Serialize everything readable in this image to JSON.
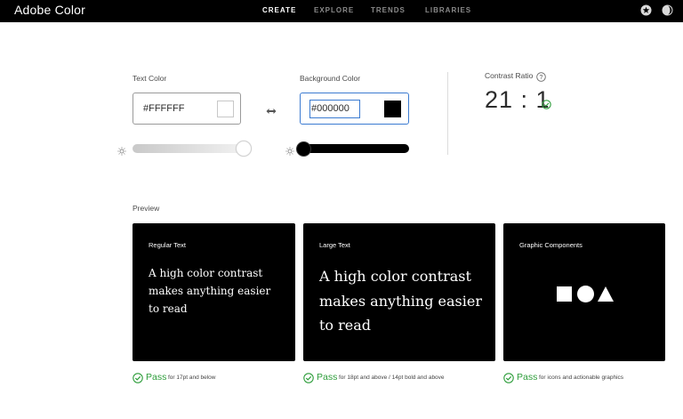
{
  "header": {
    "brand": "Adobe Color",
    "nav": [
      "CREATE",
      "EXPLORE",
      "TRENDS",
      "LIBRARIES"
    ],
    "active_nav": "CREATE",
    "icons": [
      "star-icon",
      "theme-icon"
    ]
  },
  "text_color": {
    "label": "Text Color",
    "value": "#FFFFFF",
    "brightness": 1.0
  },
  "swap_icon": "swap-arrows-icon",
  "background_color": {
    "label": "Background Color",
    "value": "#000000",
    "brightness": 0.0
  },
  "contrast": {
    "label": "Contrast Ratio",
    "help_icon": "help-icon",
    "value": "21 : 1",
    "status_icon": "check-circle-icon"
  },
  "preview": {
    "label": "Preview",
    "cards": [
      {
        "title": "Regular Text",
        "body": "A high color contrast makes anything easier to read"
      },
      {
        "title": "Large Text",
        "body": "A high color contrast makes anything easier to read"
      },
      {
        "title": "Graphic Components",
        "shapes": [
          "square",
          "circle",
          "triangle"
        ]
      }
    ],
    "results": [
      {
        "status": "Pass",
        "note": "for 17pt and below"
      },
      {
        "status": "Pass",
        "note": "for 18pt and above / 14pt bold and above"
      },
      {
        "status": "Pass",
        "note": "for icons and actionable graphics"
      }
    ]
  },
  "colors": {
    "accent": "#3b7bd1",
    "pass": "#2d9d3a",
    "card_bg": "#000000"
  }
}
